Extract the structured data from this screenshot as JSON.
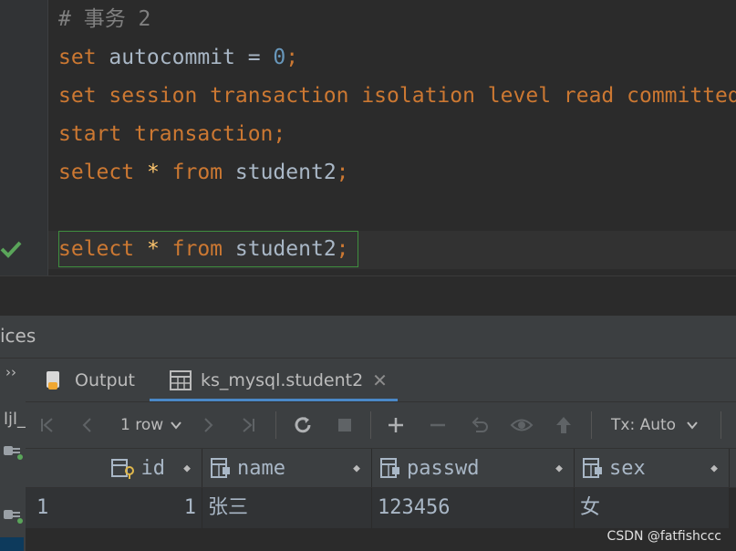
{
  "editor": {
    "lines": [
      [
        {
          "t": "# 事务 2",
          "c": "cmt"
        }
      ],
      [
        {
          "t": "set ",
          "c": "kw"
        },
        {
          "t": "autocommit = ",
          "c": "id"
        },
        {
          "t": "0",
          "c": "num"
        },
        {
          "t": ";",
          "c": "kw"
        }
      ],
      [
        {
          "t": "set session transaction isolation level read committed;",
          "c": "kw"
        }
      ],
      [
        {
          "t": "start transaction;",
          "c": "kw"
        }
      ],
      [
        {
          "t": "select ",
          "c": "kw"
        },
        {
          "t": "* ",
          "c": "star"
        },
        {
          "t": "from ",
          "c": "kw"
        },
        {
          "t": "student2",
          "c": "id"
        },
        {
          "t": ";",
          "c": "kw"
        }
      ],
      [],
      [
        {
          "t": "select ",
          "c": "kw"
        },
        {
          "t": "* ",
          "c": "star"
        },
        {
          "t": "from ",
          "c": "kw"
        },
        {
          "t": "student2",
          "c": "id"
        },
        {
          "t": ";",
          "c": "kw"
        }
      ]
    ]
  },
  "services": {
    "title": "ices",
    "chevron": "››",
    "tree_label": "ljl_"
  },
  "tabs": {
    "output": {
      "label": "Output",
      "icon": "output-icon"
    },
    "result": {
      "label": "ks_mysql.student2",
      "icon": "table-icon",
      "close": "✕"
    }
  },
  "toolbar": {
    "rows": "1 row",
    "tx": "Tx: Auto",
    "icons": [
      "first-page-icon",
      "prev-page-icon",
      "next-page-icon",
      "last-page-icon",
      "refresh-icon",
      "stop-icon",
      "add-row-icon",
      "delete-row-icon",
      "revert-icon",
      "preview-icon",
      "submit-icon"
    ]
  },
  "grid": {
    "columns": [
      {
        "name": "id",
        "icon": "primary-key-column-icon"
      },
      {
        "name": "name",
        "icon": "column-icon"
      },
      {
        "name": "passwd",
        "icon": "column-icon"
      },
      {
        "name": "sex",
        "icon": "column-icon"
      }
    ],
    "rows": [
      {
        "num": "1",
        "cells": [
          "1",
          "张三",
          "123456",
          "女"
        ]
      }
    ]
  },
  "watermark": "CSDN @fatfishccc",
  "colors": {
    "keyword": "#cc7832",
    "number": "#6897bb",
    "comment": "#808080",
    "check": "#5aa55a",
    "accent": "#4a88c7"
  }
}
